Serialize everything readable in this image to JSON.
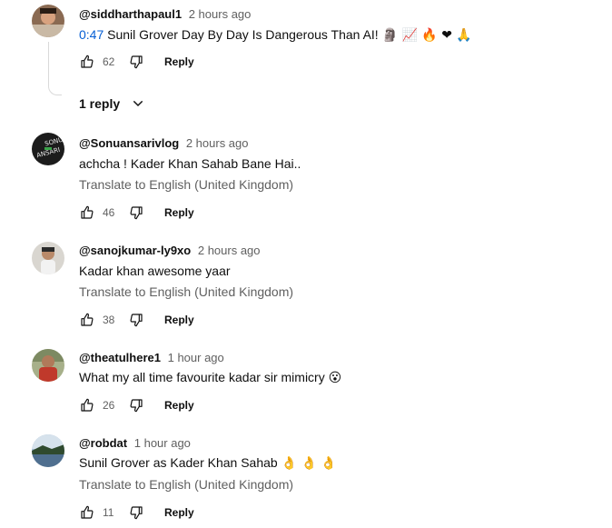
{
  "comments": [
    {
      "author": "@siddharthapaul1",
      "time": "2 hours ago",
      "timestamp": "0:47",
      "text": "Sunil Grover Day By Day Is Dangerous Than AI!",
      "emojis": "🗿 📈 🔥 ❤ 🙏",
      "likes": "62",
      "reply_label": "Reply",
      "replies_label": "1 reply"
    },
    {
      "author": "@Sonuansarivlog",
      "time": "2 hours ago",
      "text": "achcha ! Kader Khan Sahab Bane Hai..",
      "translate": "Translate to English (United Kingdom)",
      "likes": "46",
      "reply_label": "Reply"
    },
    {
      "author": "@sanojkumar-ly9xo",
      "time": "2 hours ago",
      "text": "Kadar khan awesome yaar",
      "translate": "Translate to English (United Kingdom)",
      "likes": "38",
      "reply_label": "Reply"
    },
    {
      "author": "@theatulhere1",
      "time": "1 hour ago",
      "text": "What my all time favourite kadar sir mimicry",
      "emojis": "😮",
      "likes": "26",
      "reply_label": "Reply"
    },
    {
      "author": "@robdat",
      "time": "1 hour ago",
      "text": "Sunil Grover as Kader Khan Sahab",
      "emojis": "👌 👌 👌",
      "translate": "Translate to English (United Kingdom)",
      "likes": "11",
      "reply_label": "Reply"
    }
  ],
  "colors": {
    "link": "#065fd4",
    "secondary_text": "#606060",
    "primary_text": "#0f0f0f"
  },
  "icons": [
    "like-icon",
    "dislike-icon",
    "chevron-down-icon"
  ]
}
